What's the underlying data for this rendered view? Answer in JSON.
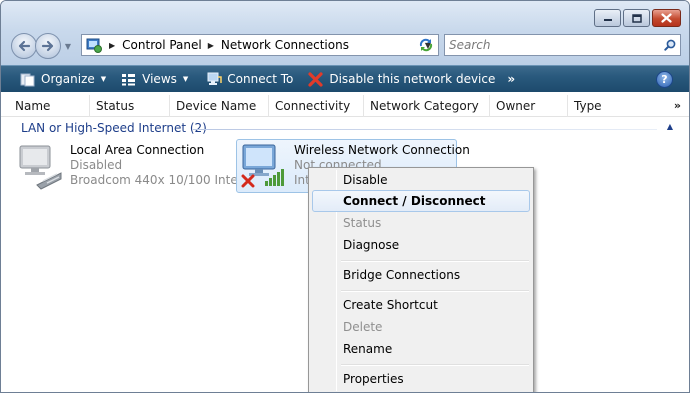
{
  "address": {
    "crumbs": [
      "Control Panel",
      "Network Connections"
    ]
  },
  "search": {
    "placeholder": "Search"
  },
  "toolbar": {
    "organize": "Organize",
    "views": "Views",
    "connect_to": "Connect To",
    "disable": "Disable this network device",
    "more": "»",
    "help": "?"
  },
  "columns": [
    "Name",
    "Status",
    "Device Name",
    "Connectivity",
    "Network Category",
    "Owner",
    "Type"
  ],
  "columns_more": "»",
  "group": {
    "label": "LAN or High-Speed Internet (2)"
  },
  "items": [
    {
      "name": "Local Area Connection",
      "status": "Disabled",
      "device": "Broadcom 440x 10/100 Integ..."
    },
    {
      "name": "Wireless Network Connection",
      "status": "Not connected",
      "device": "Int"
    }
  ],
  "context_menu": {
    "items": [
      {
        "label": "Disable",
        "state": "normal"
      },
      {
        "label": "Connect / Disconnect",
        "state": "hover-default"
      },
      {
        "label": "Status",
        "state": "disabled"
      },
      {
        "label": "Diagnose",
        "state": "normal"
      },
      {
        "label": "Bridge Connections",
        "state": "normal"
      },
      {
        "label": "Create Shortcut",
        "state": "normal"
      },
      {
        "label": "Delete",
        "state": "disabled"
      },
      {
        "label": "Rename",
        "state": "normal"
      },
      {
        "label": "Properties",
        "state": "normal"
      }
    ]
  },
  "colors": {
    "command_bar": "#29597d",
    "group_text": "#1e3e8a",
    "selection": "#dcebfb"
  },
  "icons": [
    "minimize-icon",
    "maximize-icon",
    "close-icon",
    "back-arrow-icon",
    "forward-arrow-icon",
    "control-panel-icon",
    "refresh-icon",
    "search-icon",
    "organize-icon",
    "views-icon",
    "connect-to-icon",
    "disable-icon",
    "help-icon",
    "network-adapter-icon",
    "wireless-adapter-icon",
    "signal-bars-icon",
    "disconnected-x-icon"
  ]
}
